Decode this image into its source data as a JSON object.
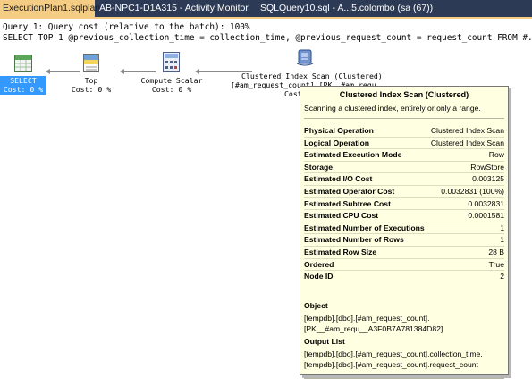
{
  "tabs": [
    {
      "label": "ExecutionPlan1.sqlplan",
      "active": true,
      "close": "✕"
    },
    {
      "label": "AB-NPC1-D1A315 - Activity Monitor",
      "active": false
    },
    {
      "label": "SQLQuery10.sql - A...5.colombo (sa (67))",
      "active": false
    }
  ],
  "query": {
    "line1": "Query 1: Query cost (relative to the batch): 100%",
    "line2": "SELECT TOP 1 @previous_collection_time = collection_time, @previous_request_count = request_count FROM #..."
  },
  "nodes": [
    {
      "name": "SELECT",
      "cost": "Cost: 0 %",
      "icon": "select-icon"
    },
    {
      "name": "Top",
      "cost": "Cost: 0 %",
      "icon": "top-icon"
    },
    {
      "name": "Compute Scalar",
      "cost": "Cost: 0 %",
      "icon": "compute-scalar-icon"
    },
    {
      "name": "Clustered Index Scan (Clustered)",
      "sub": "[#am_request_count].[PK__#am_requ...",
      "cost": "Cost",
      "icon": "clustered-index-scan-icon"
    }
  ],
  "tooltip": {
    "title": "Clustered Index Scan (Clustered)",
    "description": "Scanning a clustered index, entirely or only a range.",
    "properties": [
      {
        "key": "Physical Operation",
        "value": "Clustered Index Scan"
      },
      {
        "key": "Logical Operation",
        "value": "Clustered Index Scan"
      },
      {
        "key": "Estimated Execution Mode",
        "value": "Row"
      },
      {
        "key": "Storage",
        "value": "RowStore"
      },
      {
        "key": "Estimated I/O Cost",
        "value": "0.003125"
      },
      {
        "key": "Estimated Operator Cost",
        "value": "0.0032831 (100%)"
      },
      {
        "key": "Estimated Subtree Cost",
        "value": "0.0032831"
      },
      {
        "key": "Estimated CPU Cost",
        "value": "0.0001581"
      },
      {
        "key": "Estimated Number of Executions",
        "value": "1"
      },
      {
        "key": "Estimated Number of Rows",
        "value": "1"
      },
      {
        "key": "Estimated Row Size",
        "value": "28 B"
      },
      {
        "key": "Ordered",
        "value": "True"
      },
      {
        "key": "Node ID",
        "value": "2"
      }
    ],
    "object_label": "Object",
    "object_lines": [
      "[tempdb].[dbo].[#am_request_count].",
      "[PK__#am_requ__A3F0B7A781384D82]"
    ],
    "output_label": "Output List",
    "output_lines": [
      "[tempdb].[dbo].[#am_request_count].collection_time,",
      "[tempdb].[dbo].[#am_request_count].request_count"
    ]
  },
  "colors": {
    "tab_bar": "#2d3a55",
    "active_tab": "#f5cc84",
    "tooltip_bg": "#ffffe1",
    "selected_node": "#3399ff"
  }
}
